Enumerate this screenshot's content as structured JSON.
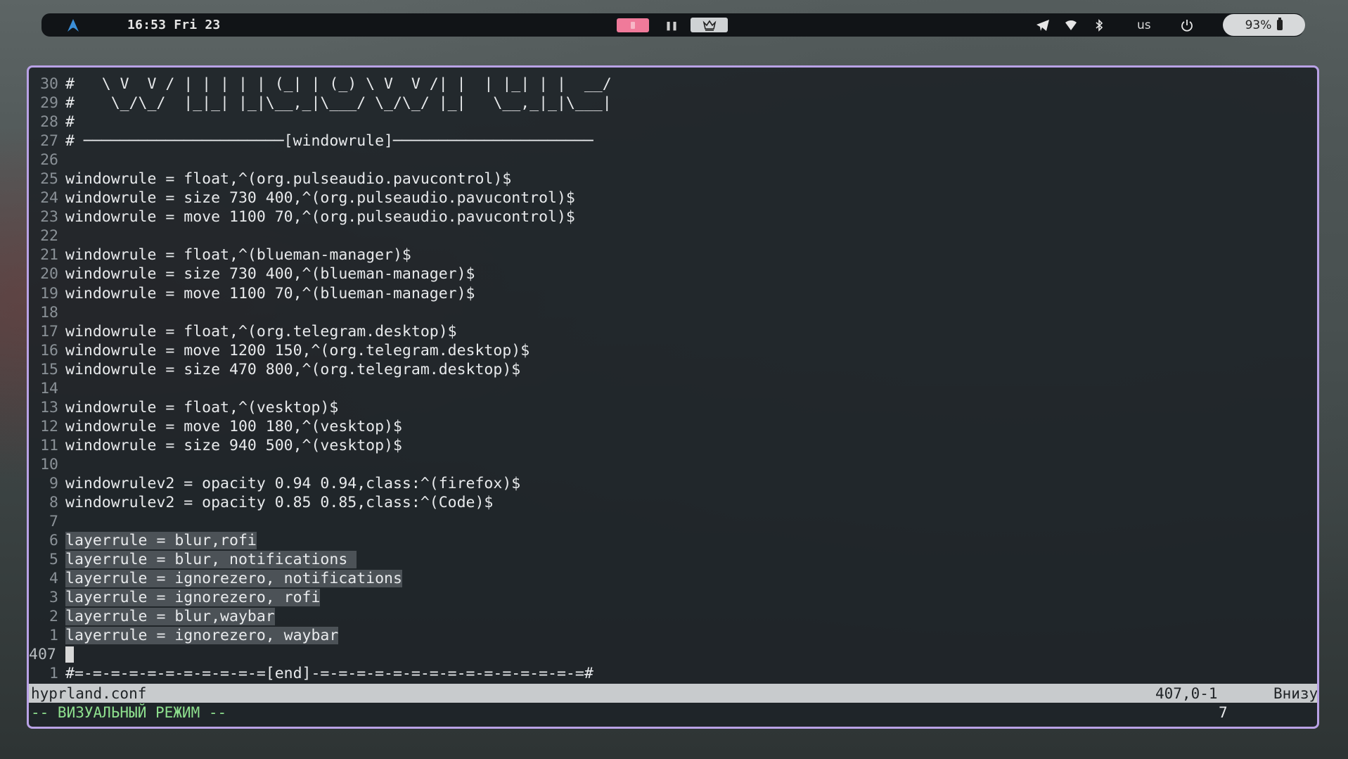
{
  "topbar": {
    "time": "16:53 Fri 23",
    "language": "us",
    "battery": "93%",
    "icons": [
      "arch-logo-icon",
      "pause-icon",
      "crown-icon",
      "telegram-icon",
      "wifi-icon",
      "bluetooth-icon",
      "power-icon",
      "battery-icon"
    ],
    "accent_workspace_color": "#f07a9a"
  },
  "editor": {
    "lines": [
      {
        "n": "30",
        "text": "#   \\ V  V / | | | | | (_| | (_) \\ V  V /| |  | |_| | |  __/",
        "hl": false
      },
      {
        "n": "29",
        "text": "#    \\_/\\_/  |_|_| |_|\\__,_|\\___/ \\_/\\_/ |_|   \\__,_|_|\\___|",
        "hl": false
      },
      {
        "n": "28",
        "text": "#",
        "hl": false
      },
      {
        "n": "27",
        "text": "# ──────────────────────[windowrule]──────────────────────",
        "hl": false
      },
      {
        "n": "26",
        "text": "",
        "hl": false
      },
      {
        "n": "25",
        "text": "windowrule = float,^(org.pulseaudio.pavucontrol)$",
        "hl": false
      },
      {
        "n": "24",
        "text": "windowrule = size 730 400,^(org.pulseaudio.pavucontrol)$",
        "hl": false
      },
      {
        "n": "23",
        "text": "windowrule = move 1100 70,^(org.pulseaudio.pavucontrol)$",
        "hl": false
      },
      {
        "n": "22",
        "text": "",
        "hl": false
      },
      {
        "n": "21",
        "text": "windowrule = float,^(blueman-manager)$",
        "hl": false
      },
      {
        "n": "20",
        "text": "windowrule = size 730 400,^(blueman-manager)$",
        "hl": false
      },
      {
        "n": "19",
        "text": "windowrule = move 1100 70,^(blueman-manager)$",
        "hl": false
      },
      {
        "n": "18",
        "text": "",
        "hl": false
      },
      {
        "n": "17",
        "text": "windowrule = float,^(org.telegram.desktop)$",
        "hl": false
      },
      {
        "n": "16",
        "text": "windowrule = move 1200 150,^(org.telegram.desktop)$",
        "hl": false
      },
      {
        "n": "15",
        "text": "windowrule = size 470 800,^(org.telegram.desktop)$",
        "hl": false
      },
      {
        "n": "14",
        "text": "",
        "hl": false
      },
      {
        "n": "13",
        "text": "windowrule = float,^(vesktop)$",
        "hl": false
      },
      {
        "n": "12",
        "text": "windowrule = move 100 180,^(vesktop)$",
        "hl": false
      },
      {
        "n": "11",
        "text": "windowrule = size 940 500,^(vesktop)$",
        "hl": false
      },
      {
        "n": "10",
        "text": "",
        "hl": false
      },
      {
        "n": "9",
        "text": "windowrulev2 = opacity 0.94 0.94,class:^(firefox)$",
        "hl": false
      },
      {
        "n": "8",
        "text": "windowrulev2 = opacity 0.85 0.85,class:^(Code)$",
        "hl": false
      },
      {
        "n": "7",
        "text": "",
        "hl": false
      },
      {
        "n": "6",
        "text": "layerrule = blur,rofi",
        "hl": true
      },
      {
        "n": "5",
        "text": "layerrule = blur, notifications ",
        "hl": true
      },
      {
        "n": "4",
        "text": "layerrule = ignorezero, notifications",
        "hl": true
      },
      {
        "n": "3",
        "text": "layerrule = ignorezero, rofi",
        "hl": true
      },
      {
        "n": "2",
        "text": "layerrule = blur,waybar",
        "hl": true
      },
      {
        "n": "1",
        "text": "layerrule = ignorezero, waybar",
        "hl": true
      }
    ],
    "current_line": "407",
    "last_line_number": "1",
    "last_line_text": "#=-=-=-=-=-=-=-=-=-=-=[end]-=-=-=-=-=-=-=-=-=-=-=-=-=-=-=#"
  },
  "statusline": {
    "filename": "hyprland.conf",
    "position": "407,0-1",
    "where": "Внизу"
  },
  "modeline": {
    "mode": "-- ВИЗУАЛЬНЫЙ РЕЖИМ --",
    "count": "7"
  }
}
